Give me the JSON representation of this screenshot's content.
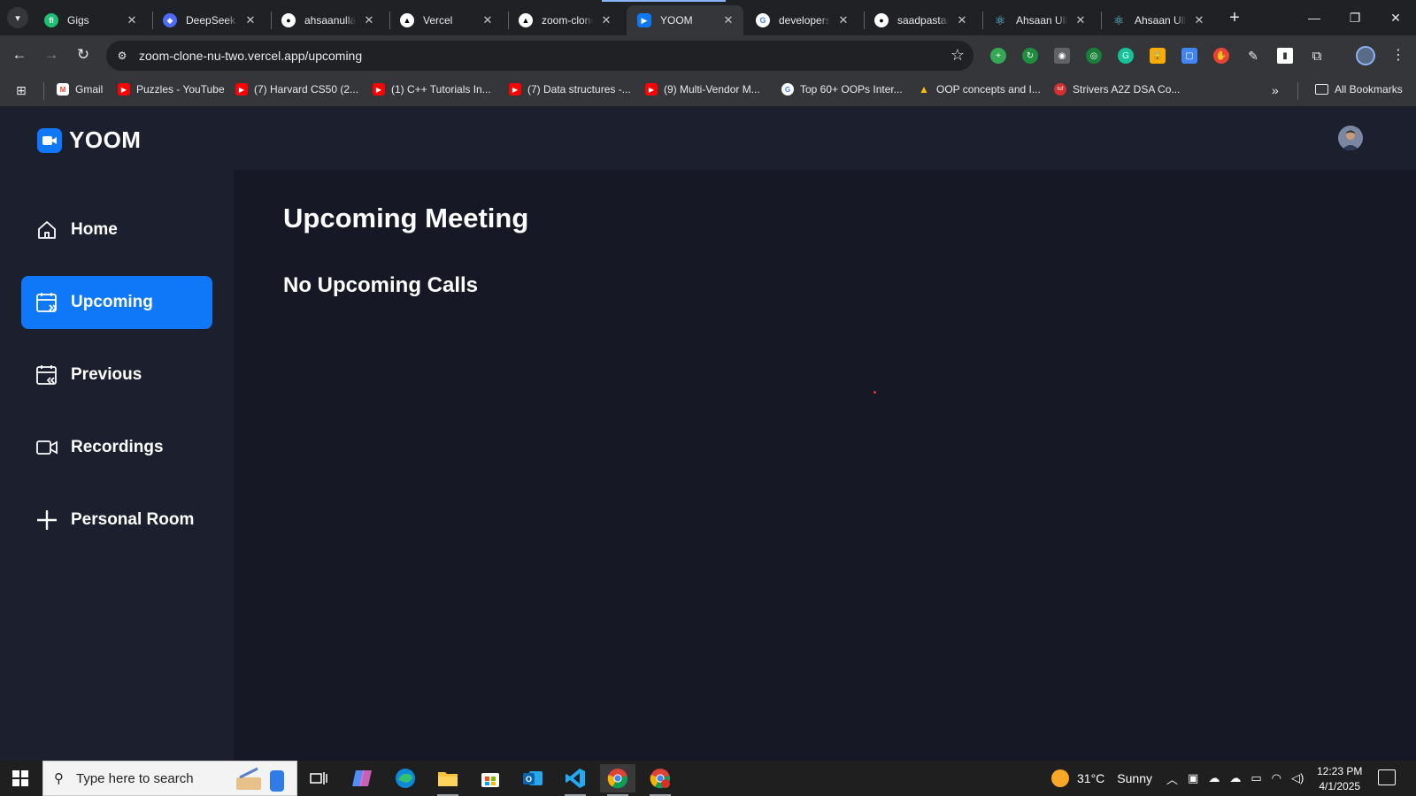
{
  "browser": {
    "tabs": [
      {
        "title": "Gigs",
        "fav_color": "#1dbf73",
        "fav_glyph": "fi"
      },
      {
        "title": "DeepSeek -",
        "fav_color": "#4d6bfe",
        "fav_glyph": "🐳"
      },
      {
        "title": "ahsaanullah",
        "fav_color": "#ffffff",
        "fav_glyph": "gh"
      },
      {
        "title": "Vercel",
        "fav_color": "#000000",
        "fav_glyph": "▲"
      },
      {
        "title": "zoom-clone",
        "fav_color": "#000000",
        "fav_glyph": "▲"
      },
      {
        "title": "YOOM",
        "fav_color": "#0e78f9",
        "fav_glyph": "▶",
        "active": true
      },
      {
        "title": "developers",
        "fav_color": "#ffffff",
        "fav_glyph": "G"
      },
      {
        "title": "saadpasta/c",
        "fav_color": "#ffffff",
        "fav_glyph": "gh"
      },
      {
        "title": "Ahsaan Ulla",
        "fav_color": "#61dafb",
        "fav_glyph": "⚛"
      },
      {
        "title": "Ahsaan Ulla",
        "fav_color": "#61dafb",
        "fav_glyph": "⚛"
      }
    ],
    "url": "zoom-clone-nu-two.vercel.app/upcoming",
    "bookmarks": [
      {
        "label": "Gmail",
        "icon_color": "#ea4335",
        "glyph": "M"
      },
      {
        "label": "Puzzles - YouTube",
        "icon_color": "#ff0000",
        "glyph": "▶"
      },
      {
        "label": "(7) Harvard CS50 (2...",
        "icon_color": "#ff0000",
        "glyph": "▶"
      },
      {
        "label": "(1) C++ Tutorials In...",
        "icon_color": "#ff0000",
        "glyph": "▶"
      },
      {
        "label": "(7) Data structures -...",
        "icon_color": "#ff0000",
        "glyph": "▶"
      },
      {
        "label": "(9) Multi-Vendor M...",
        "icon_color": "#ff0000",
        "glyph": "▶"
      },
      {
        "label": "Top 60+ OOPs Inter...",
        "icon_color": "#ffffff",
        "glyph": "G"
      },
      {
        "label": "OOP concepts and I...",
        "icon_color": "#fbbc04",
        "glyph": "▲"
      },
      {
        "label": "Strivers A2Z DSA Co...",
        "icon_color": "#d32f2f",
        "glyph": "tuf"
      }
    ],
    "all_bookmarks_label": "All Bookmarks"
  },
  "app": {
    "brand": "YOOM",
    "page_title": "Upcoming Meeting",
    "empty_message": "No Upcoming Calls",
    "accent_color": "#0e78f9",
    "sidebar": [
      {
        "label": "Home",
        "icon": "home-icon",
        "active": false
      },
      {
        "label": "Upcoming",
        "icon": "calendar-upcoming-icon",
        "active": true
      },
      {
        "label": "Previous",
        "icon": "calendar-previous-icon",
        "active": false
      },
      {
        "label": "Recordings",
        "icon": "video-icon",
        "active": false
      },
      {
        "label": "Personal Room",
        "icon": "plus-icon",
        "active": false
      }
    ]
  },
  "taskbar": {
    "search_placeholder": "Type here to search",
    "weather": {
      "temp": "31°C",
      "condition": "Sunny"
    },
    "time": "12:23 PM",
    "date": "4/1/2025"
  }
}
